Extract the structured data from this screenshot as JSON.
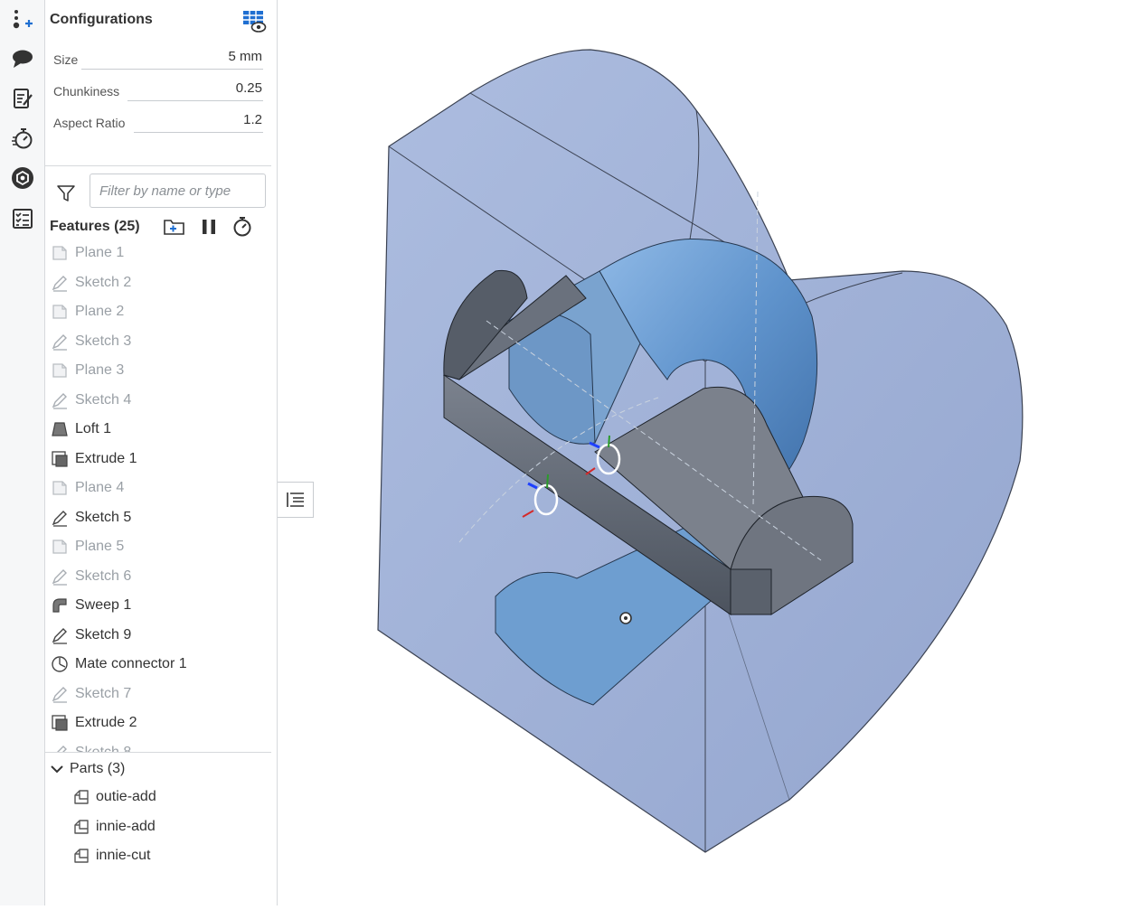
{
  "configurations": {
    "title": "Configurations",
    "rows": [
      {
        "label": "Size",
        "value": "5 mm"
      },
      {
        "label": "Chunkiness",
        "value": "0.25"
      },
      {
        "label": "Aspect Ratio",
        "value": "1.2"
      }
    ]
  },
  "filter": {
    "placeholder": "Filter by name or type"
  },
  "features": {
    "title": "Features (25)",
    "items": [
      {
        "label": "Plane 1",
        "type": "plane",
        "suppressed": true
      },
      {
        "label": "Sketch 2",
        "type": "sketch",
        "suppressed": true
      },
      {
        "label": "Plane 2",
        "type": "plane",
        "suppressed": true
      },
      {
        "label": "Sketch 3",
        "type": "sketch",
        "suppressed": true
      },
      {
        "label": "Plane 3",
        "type": "plane",
        "suppressed": true
      },
      {
        "label": "Sketch 4",
        "type": "sketch",
        "suppressed": true
      },
      {
        "label": "Loft 1",
        "type": "loft",
        "suppressed": false
      },
      {
        "label": "Extrude 1",
        "type": "extrude",
        "suppressed": false
      },
      {
        "label": "Plane 4",
        "type": "plane",
        "suppressed": true
      },
      {
        "label": "Sketch 5",
        "type": "sketch",
        "suppressed": false
      },
      {
        "label": "Plane 5",
        "type": "plane",
        "suppressed": true
      },
      {
        "label": "Sketch 6",
        "type": "sketch",
        "suppressed": true
      },
      {
        "label": "Sweep 1",
        "type": "sweep",
        "suppressed": false
      },
      {
        "label": "Sketch 9",
        "type": "sketch",
        "suppressed": false
      },
      {
        "label": "Mate connector 1",
        "type": "mate",
        "suppressed": false
      },
      {
        "label": "Sketch 7",
        "type": "sketch",
        "suppressed": true
      },
      {
        "label": "Extrude 2",
        "type": "extrude",
        "suppressed": false
      },
      {
        "label": "Sketch 8",
        "type": "sketch",
        "suppressed": true
      }
    ]
  },
  "parts": {
    "title": "Parts (3)",
    "items": [
      {
        "label": "outie-add"
      },
      {
        "label": "innie-add"
      },
      {
        "label": "innie-cut"
      }
    ]
  },
  "colors": {
    "accent": "#1f6fd1",
    "part_blue": "#6e9ed0",
    "body_gray": "#5f6672",
    "transparent_block": "#8fa4cf"
  },
  "icons": {
    "rail": [
      "insert-mate-icon",
      "comment-icon",
      "notes-icon",
      "timer-icon",
      "appearance-icon",
      "checklist-icon"
    ],
    "toolbar": [
      "add-folder-icon",
      "pause-icon",
      "rollback-timer-icon"
    ]
  }
}
